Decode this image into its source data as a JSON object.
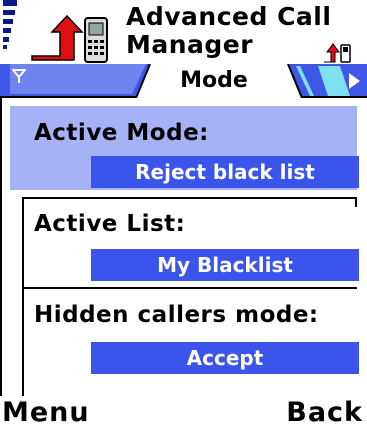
{
  "header": {
    "title_line1": "Advanced Call",
    "title_line2": "Manager"
  },
  "icons": {
    "app": "phone-arrow-icon",
    "signal": "signal-strength-icon",
    "battery": "battery-icon",
    "small_phone": "small-phone-arrow-icon",
    "left_arrow": "tab-scroll-left-icon",
    "right_arrow": "tab-scroll-right-icon"
  },
  "tabs": {
    "active_label": "Mode"
  },
  "settings": [
    {
      "label": "Active Mode:",
      "value": "Reject black list",
      "selected": true
    },
    {
      "label": "Active List:",
      "value": "My Blacklist",
      "selected": false
    },
    {
      "label": "Hidden callers mode:",
      "value": "Accept",
      "selected": false
    }
  ],
  "softkeys": {
    "left": "Menu",
    "right": "Back"
  },
  "colors": {
    "accent": "#3b55ec",
    "selection": "#a5b2f6",
    "status": "#0a1a8a"
  }
}
